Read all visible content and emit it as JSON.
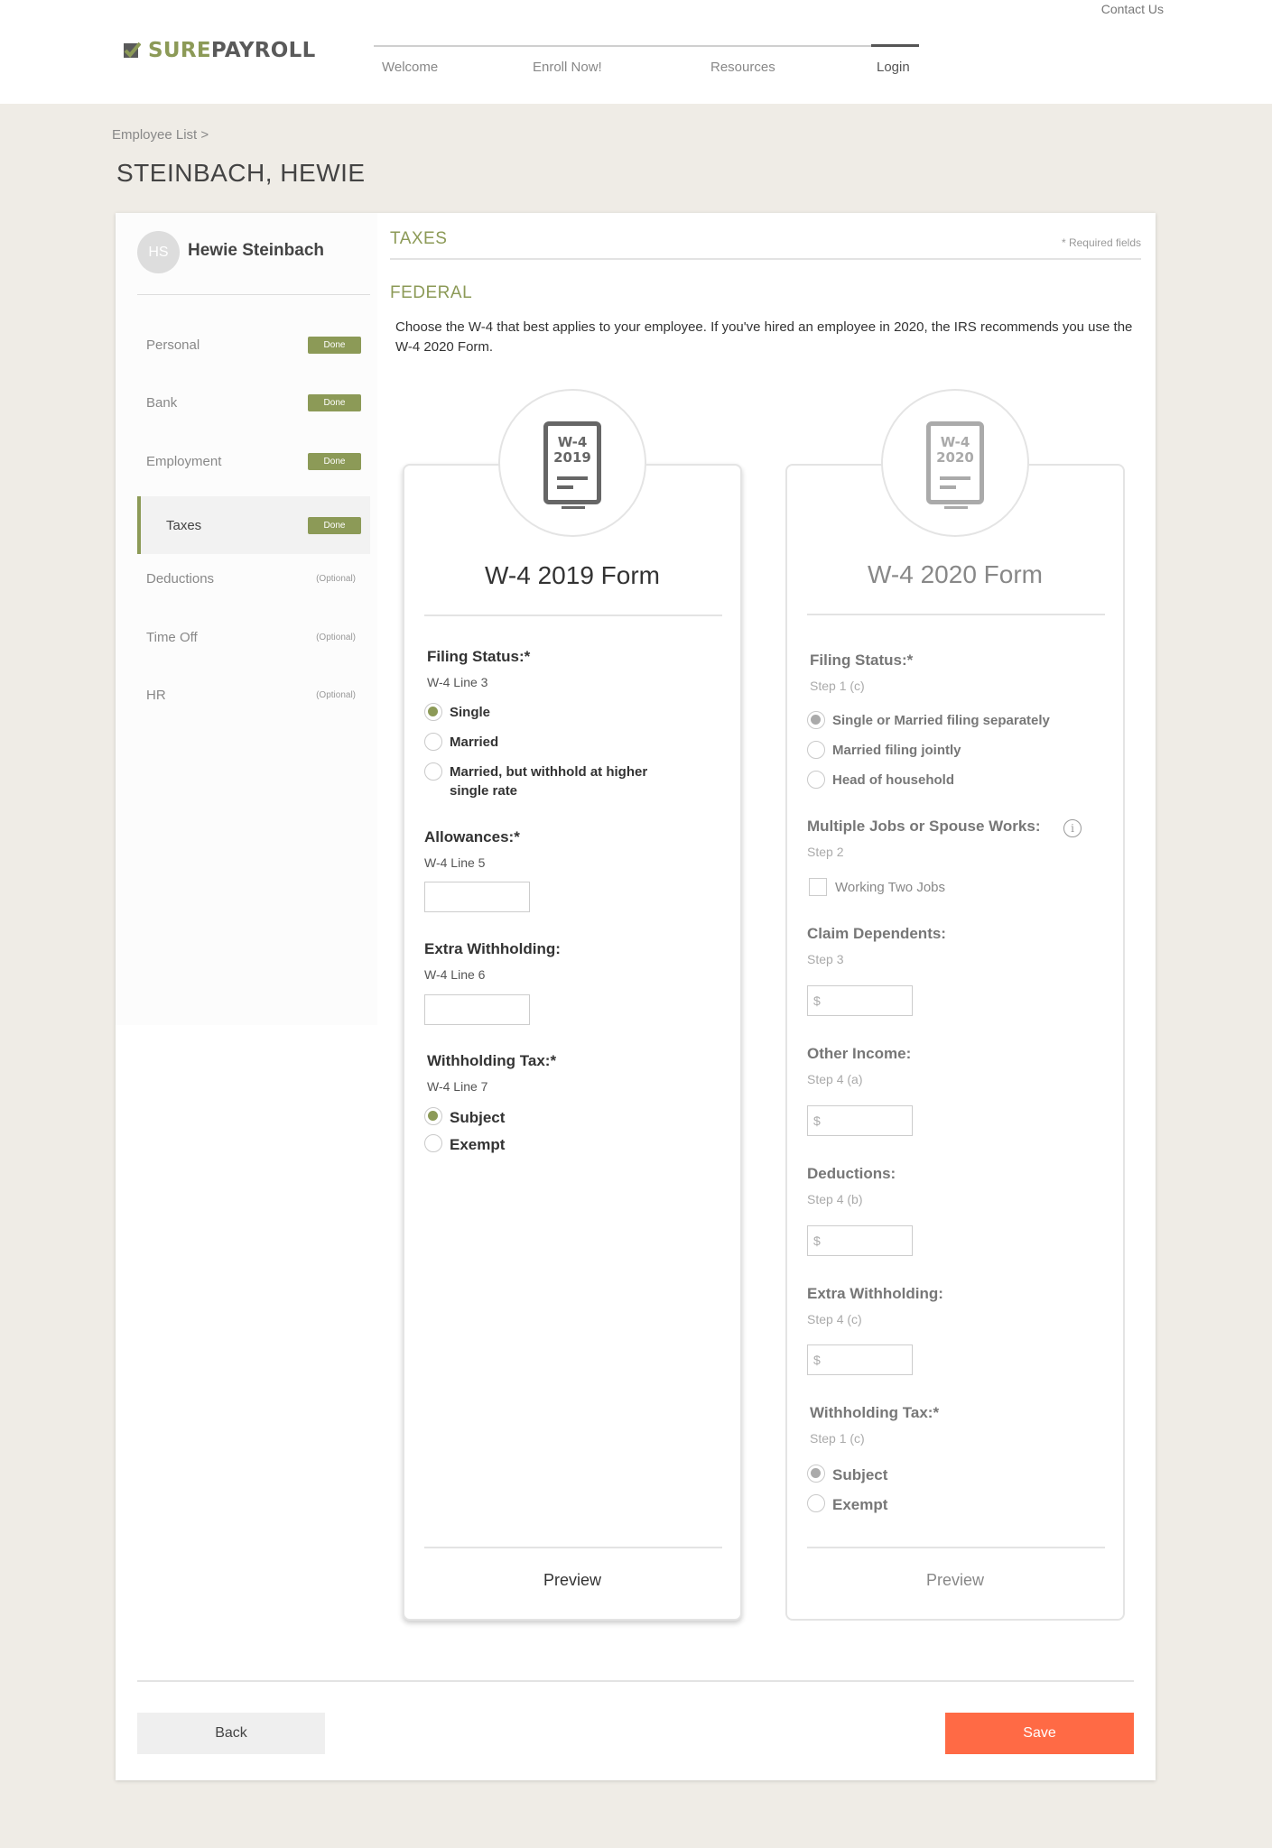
{
  "header": {
    "contact_label": "Contact Us",
    "logo": {
      "sure": "SURE",
      "payroll": "PAYROLL"
    },
    "nav": [
      {
        "label": "Welcome"
      },
      {
        "label": "Enroll Now!"
      },
      {
        "label": "Resources"
      },
      {
        "label": "Login"
      }
    ],
    "active_nav": "Login"
  },
  "breadcrumb": "Employee List >",
  "page_title": "STEINBACH, HEWIE",
  "sidebar": {
    "avatar_initials": "HS",
    "user_name": "Hewie Steinbach",
    "items": [
      {
        "label": "Personal",
        "badge": "Done"
      },
      {
        "label": "Bank",
        "badge": "Done"
      },
      {
        "label": "Employment",
        "badge": "Done"
      },
      {
        "label": "Taxes",
        "badge": "Done"
      },
      {
        "label": "Deductions",
        "badge": "(Optional)"
      },
      {
        "label": "Time Off",
        "badge": "(Optional)"
      },
      {
        "label": "HR",
        "badge": "(Optional)"
      }
    ],
    "active_item": "Taxes"
  },
  "taxes": {
    "title": "TAXES",
    "required_note": "* Required fields",
    "federal_title": "FEDERAL",
    "intro": "Choose the W-4 that best applies to your employee. If you've hired an employee in 2020, the IRS recommends you use the W-4 2020 Form."
  },
  "form2019": {
    "icon_line1": "W-4",
    "icon_line2": "2019",
    "title": "W-4 2019 Form",
    "filing_status": {
      "label": "Filing Status:*",
      "sub": "W-4 Line 3",
      "options": [
        "Single",
        "Married",
        "Married, but withhold at higher single rate"
      ],
      "selected": "Single"
    },
    "allowances": {
      "label": "Allowances:*",
      "sub": "W-4 Line 5",
      "value": ""
    },
    "extra_withholding": {
      "label": "Extra Withholding:",
      "sub": "W-4 Line 6",
      "value": ""
    },
    "withholding_tax": {
      "label": "Withholding Tax:*",
      "sub": "W-4 Line 7",
      "options": [
        "Subject",
        "Exempt"
      ],
      "selected": "Subject"
    },
    "preview_label": "Preview"
  },
  "form2020": {
    "icon_line1": "W-4",
    "icon_line2": "2020",
    "title": "W-4 2020 Form",
    "filing_status": {
      "label": "Filing Status:*",
      "sub": "Step 1 (c)",
      "options": [
        "Single or Married filing separately",
        "Married filing jointly",
        "Head of household"
      ],
      "selected": "Single or Married filing separately"
    },
    "multiple_jobs": {
      "label": "Multiple Jobs or Spouse Works:",
      "info_icon": "i",
      "sub": "Step 2",
      "checkbox_label": "Working Two Jobs",
      "checked": false
    },
    "claim_dependents": {
      "label": "Claim Dependents:",
      "sub": "Step 3",
      "placeholder": "$"
    },
    "other_income": {
      "label": "Other Income:",
      "sub": "Step 4 (a)",
      "placeholder": "$"
    },
    "deductions": {
      "label": "Deductions:",
      "sub": "Step 4 (b)",
      "placeholder": "$"
    },
    "extra_withholding": {
      "label": "Extra Withholding:",
      "sub": "Step 4 (c)",
      "placeholder": "$"
    },
    "withholding_tax": {
      "label": "Withholding Tax:*",
      "sub": "Step 1 (c)",
      "options": [
        "Subject",
        "Exempt"
      ],
      "selected": "Subject"
    },
    "preview_label": "Preview"
  },
  "footer": {
    "back_label": "Back",
    "save_label": "Save"
  },
  "colors": {
    "brand_green": "#8c9a57",
    "save_orange": "#ff6a45",
    "page_bg": "#efece6"
  }
}
